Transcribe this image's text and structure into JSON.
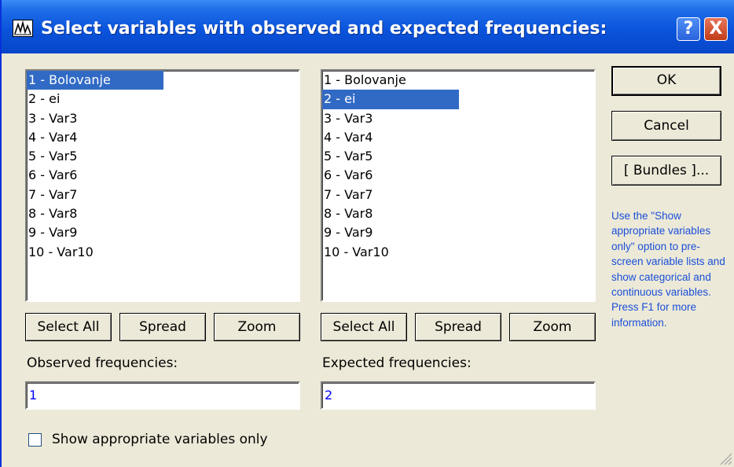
{
  "window": {
    "title": "Select variables with observed and expected frequencies:"
  },
  "title_buttons": {
    "help": "?",
    "close": "X"
  },
  "variables": [
    "1 - Bolovanje",
    "2 - ei",
    "3 - Var3",
    "4 - Var4",
    "5 - Var5",
    "6 - Var6",
    "7 - Var7",
    "8 - Var8",
    "9 - Var9",
    "10 - Var10"
  ],
  "left_list": {
    "selected_index": 0
  },
  "right_list": {
    "selected_index": 1
  },
  "left_buttons": {
    "select_all": "Select All",
    "spread": "Spread",
    "zoom": "Zoom"
  },
  "right_buttons": {
    "select_all": "Select All",
    "spread": "Spread",
    "zoom": "Zoom"
  },
  "observed": {
    "label": "Observed frequencies:",
    "value": "1"
  },
  "expected": {
    "label": "Expected frequencies:",
    "value": "2"
  },
  "actions": {
    "ok": "OK",
    "cancel": "Cancel",
    "bundles": "[ Bundles ]..."
  },
  "hint": "Use the \"Show appropriate variables only\" option to pre-screen variable lists and show categorical and continuous variables. Press F1 for more information.",
  "show_appropriate": {
    "label": "Show appropriate variables only",
    "checked": false
  },
  "colors": {
    "selection": "#316ac5",
    "hint_text": "#1a4fd8",
    "field_text": "#0000ff",
    "title_bar": "#0a54dc"
  }
}
